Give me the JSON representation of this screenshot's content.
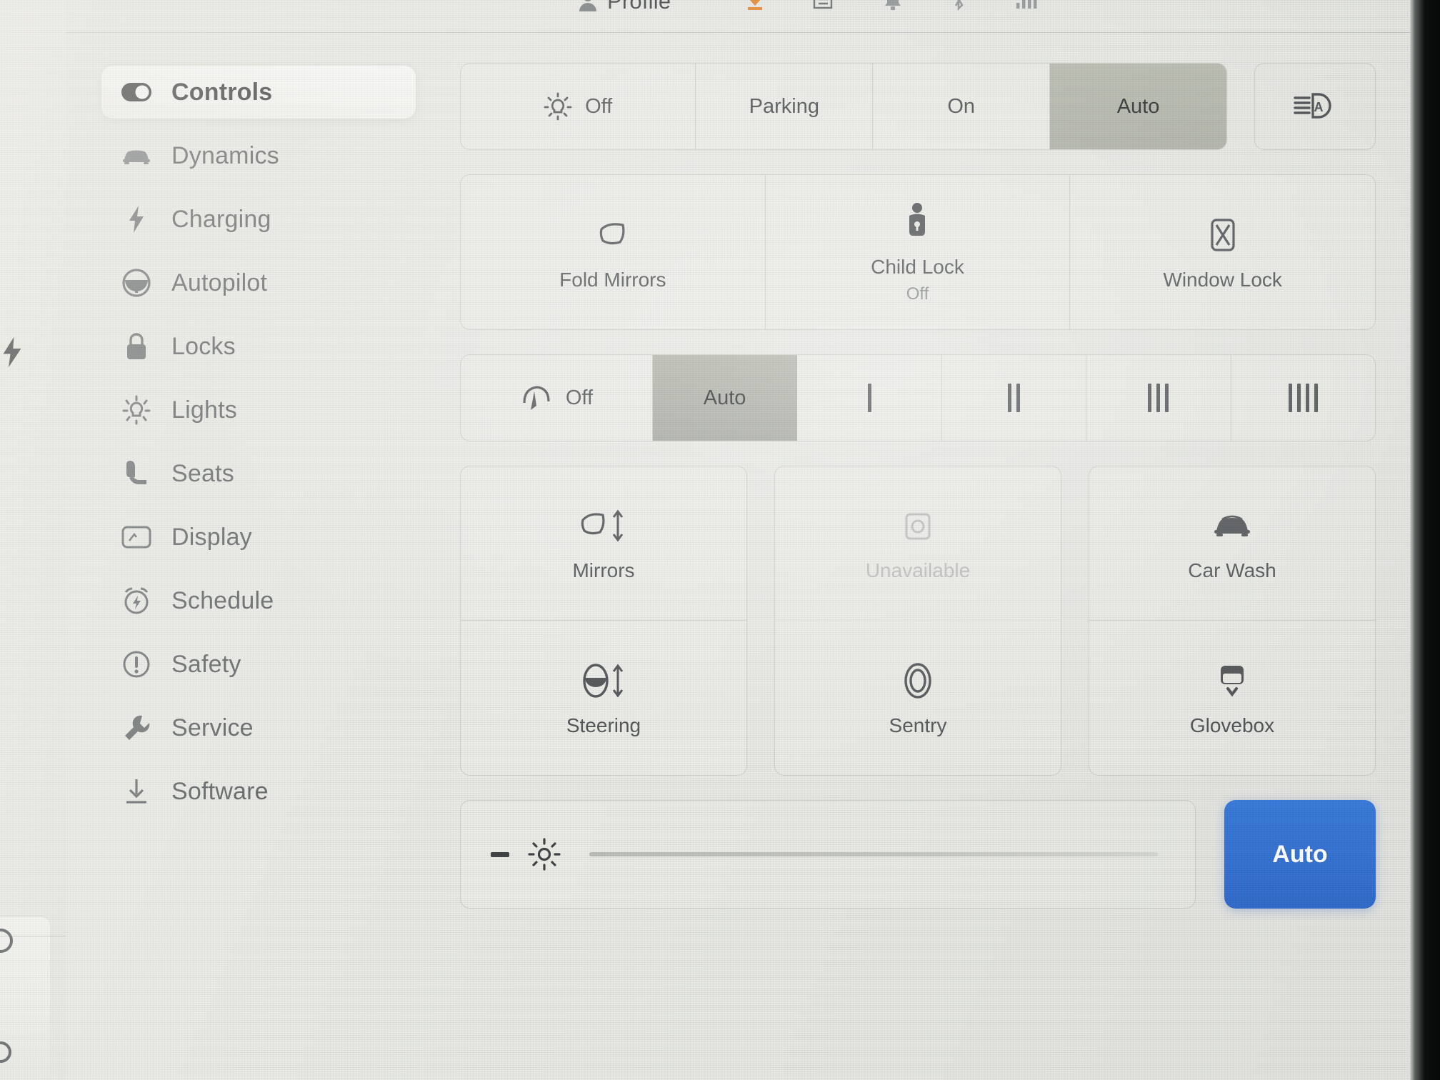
{
  "statusbar": {
    "profile_label": "Profile",
    "icons": [
      "person-icon",
      "software-update-icon",
      "list-icon",
      "bell-icon",
      "bluetooth-off-icon",
      "signal-bars-icon"
    ],
    "update_color": "#e2801f"
  },
  "sidebar": {
    "items": [
      {
        "label": "Controls",
        "icon": "toggle-switch-icon",
        "active": true
      },
      {
        "label": "Dynamics",
        "icon": "car-front-icon",
        "active": false
      },
      {
        "label": "Charging",
        "icon": "lightning-bolt-icon",
        "active": false
      },
      {
        "label": "Autopilot",
        "icon": "steering-wheel-icon",
        "active": false
      },
      {
        "label": "Locks",
        "icon": "padlock-icon",
        "active": false
      },
      {
        "label": "Lights",
        "icon": "sun-rays-icon",
        "active": false
      },
      {
        "label": "Seats",
        "icon": "car-seat-icon",
        "active": false
      },
      {
        "label": "Display",
        "icon": "screen-icon",
        "active": false
      },
      {
        "label": "Schedule",
        "icon": "alarm-clock-icon",
        "active": false
      },
      {
        "label": "Safety",
        "icon": "exclamation-circle-icon",
        "active": false
      },
      {
        "label": "Service",
        "icon": "wrench-icon",
        "active": false
      },
      {
        "label": "Software",
        "icon": "download-icon",
        "active": false
      }
    ]
  },
  "lights_row": {
    "icon": "headlight-sun-icon",
    "segments": [
      {
        "label": "Off",
        "selected": false
      },
      {
        "label": "Parking",
        "selected": false
      },
      {
        "label": "On",
        "selected": false
      },
      {
        "label": "Auto",
        "selected": true
      }
    ],
    "auto_highbeam_icon": "auto-high-beam-icon",
    "selected_bg": "#a9ac9f"
  },
  "mirror_row": {
    "tiles": [
      {
        "label": "Fold Mirrors",
        "sub": "",
        "icon": "mirror-icon",
        "disabled": false
      },
      {
        "label": "Child Lock",
        "sub": "Off",
        "icon": "child-lock-icon",
        "disabled": false
      },
      {
        "label": "Window Lock",
        "sub": "",
        "icon": "window-lock-icon",
        "disabled": false
      }
    ]
  },
  "wiper_row": {
    "icon": "wiper-icon",
    "segments": [
      {
        "label": "Off",
        "selected": false,
        "ticks": 0
      },
      {
        "label": "Auto",
        "selected": true,
        "ticks": 0
      },
      {
        "label": "",
        "selected": false,
        "ticks": 1
      },
      {
        "label": "",
        "selected": false,
        "ticks": 2
      },
      {
        "label": "",
        "selected": false,
        "ticks": 3
      },
      {
        "label": "",
        "selected": false,
        "ticks": 4
      }
    ],
    "selected_bg": "#a4a79b"
  },
  "tiles": {
    "col1": [
      {
        "label": "Mirrors",
        "icon": "mirror-adjust-icon",
        "disabled": false
      },
      {
        "label": "Steering",
        "icon": "steering-adjust-icon",
        "disabled": false
      }
    ],
    "col2": [
      {
        "label": "Unavailable",
        "icon": "camera-icon",
        "disabled": true
      },
      {
        "label": "Sentry",
        "icon": "sentry-eye-icon",
        "disabled": false
      }
    ],
    "col3": [
      {
        "label": "Car Wash",
        "icon": "car-wash-icon",
        "disabled": false
      },
      {
        "label": "Glovebox",
        "icon": "glovebox-icon",
        "disabled": false
      }
    ]
  },
  "brightness": {
    "minus_label": "minus-icon",
    "icon": "brightness-sun-icon",
    "auto_label": "Auto",
    "auto_color": "#1f5fc6",
    "slider_value_percent": 0
  }
}
